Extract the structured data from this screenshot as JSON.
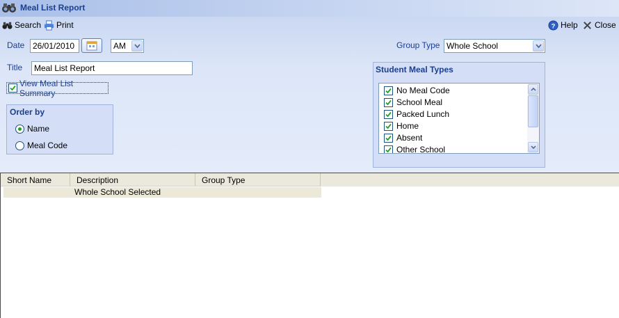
{
  "window": {
    "title": "Meal List Report"
  },
  "toolbar": {
    "search_label": "Search",
    "print_label": "Print",
    "help_label": "Help",
    "close_label": "Close"
  },
  "form": {
    "date_label": "Date",
    "date_value": "26/01/2010",
    "period_value": "AM",
    "title_label": "Title",
    "title_value": "Meal List Report",
    "summary_label": "View Meal List Summary",
    "summary_checked": true,
    "group_type_label": "Group Type",
    "group_type_value": "Whole School"
  },
  "order_by": {
    "title": "Order by",
    "options": [
      {
        "label": "Name",
        "selected": true
      },
      {
        "label": "Meal Code",
        "selected": false
      }
    ]
  },
  "meal_types": {
    "title": "Student Meal Types",
    "items": [
      {
        "label": "No Meal Code",
        "checked": true
      },
      {
        "label": "School Meal",
        "checked": true
      },
      {
        "label": "Packed Lunch",
        "checked": true
      },
      {
        "label": "Home",
        "checked": true
      },
      {
        "label": "Absent",
        "checked": true
      },
      {
        "label": "Other School",
        "checked": true
      }
    ]
  },
  "grid": {
    "columns": [
      "Short Name",
      "Description",
      "Group Type"
    ],
    "rows": [
      {
        "short_name": "",
        "description": "Whole School Selected",
        "group_type": ""
      }
    ]
  },
  "colors": {
    "accent_text": "#1b3f8f",
    "panel_bg": "#dce6f8",
    "grid_header_bg": "#ebe9dc",
    "check_green": "#21a121"
  },
  "icons": {
    "title": "binoculars-icon",
    "search": "binoculars-icon",
    "print": "printer-icon",
    "help": "help-icon",
    "close": "close-icon",
    "calendar": "calendar-icon"
  }
}
